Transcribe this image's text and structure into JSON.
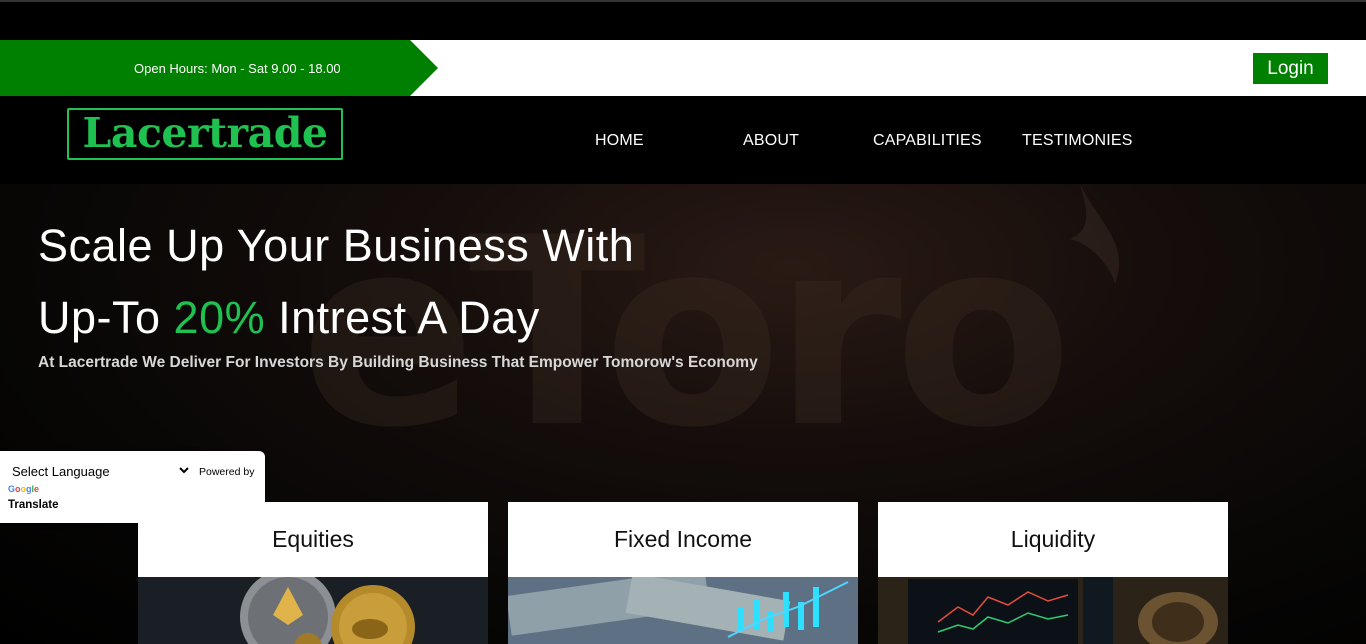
{
  "topbar": {
    "open_hours": "Open Hours: Mon - Sat 9.00 - 18.00",
    "login_label": "Login",
    "accent": "#008000"
  },
  "nav": {
    "logo_text": "Lacertrade",
    "logo_color": "#1fc150",
    "links": [
      "HOME",
      "ABOUT",
      "CAPABILITIES",
      "TESTIMONIES"
    ]
  },
  "hero": {
    "watermark": "eToro",
    "line1": "Scale Up Your Business With",
    "line2_pre": "Up-To ",
    "line2_highlight": "20%",
    "line2_post": " Intrest A Day",
    "subtitle": "At Lacertrade We Deliver For Investors By Building Business That Empower Tomorow's Economy"
  },
  "translate_widget": {
    "select_value": "Select Language",
    "powered_by": "Powered by",
    "google": "Google",
    "translate": "Translate"
  },
  "cards": [
    {
      "title": "Equities",
      "image": "coins-photo"
    },
    {
      "title": "Fixed Income",
      "image": "dollar-chart-photo"
    },
    {
      "title": "Liquidity",
      "image": "trading-screen-photo"
    }
  ]
}
